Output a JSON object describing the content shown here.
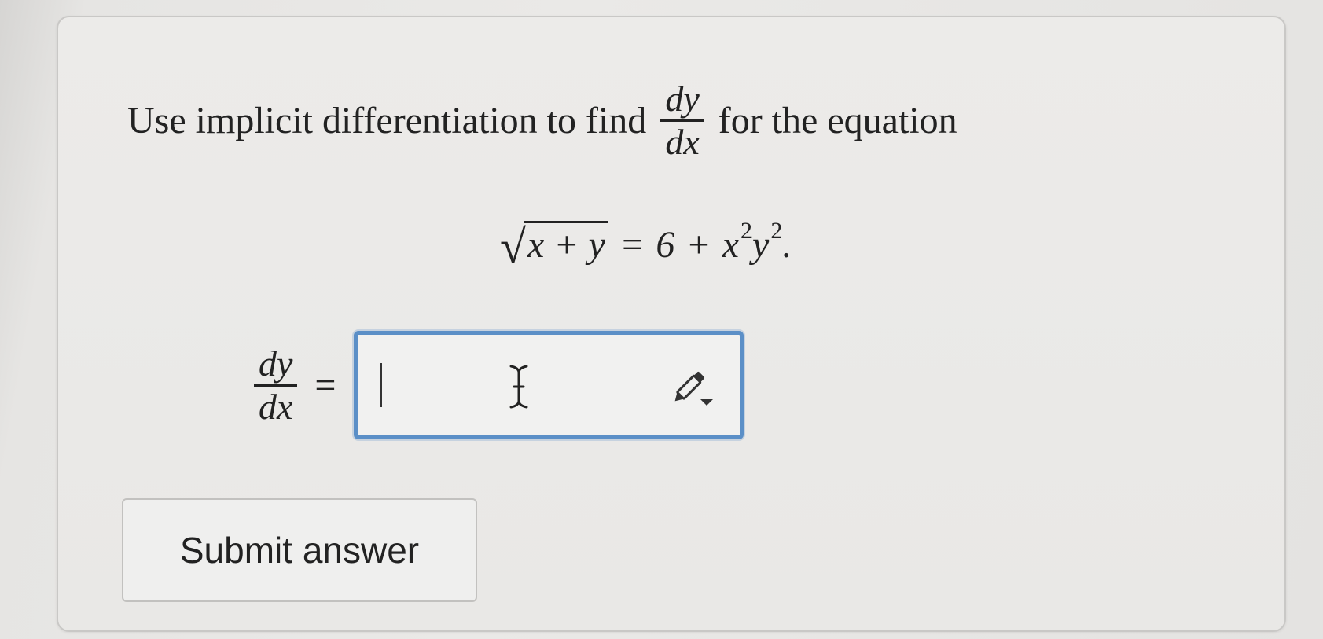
{
  "question": {
    "prefix": "Use implicit differentiation to find",
    "frac_num": "dy",
    "frac_den": "dx",
    "suffix": "for the equation"
  },
  "equation": {
    "radicand": "x + y",
    "equals": "=",
    "constant": "6",
    "plus": "+",
    "term_x": "x",
    "exp_x": "2",
    "term_y": "y",
    "exp_y": "2",
    "period": "."
  },
  "answer": {
    "lhs_num": "dy",
    "lhs_den": "dx",
    "equals": "=",
    "value": ""
  },
  "submit": {
    "label": "Submit answer"
  },
  "icons": {
    "caret": "text-caret",
    "cursor": "ibeam-cursor-icon",
    "tool": "pencil-dropdown-icon"
  },
  "colors": {
    "input_border": "#5b8fc7",
    "text": "#222222"
  }
}
